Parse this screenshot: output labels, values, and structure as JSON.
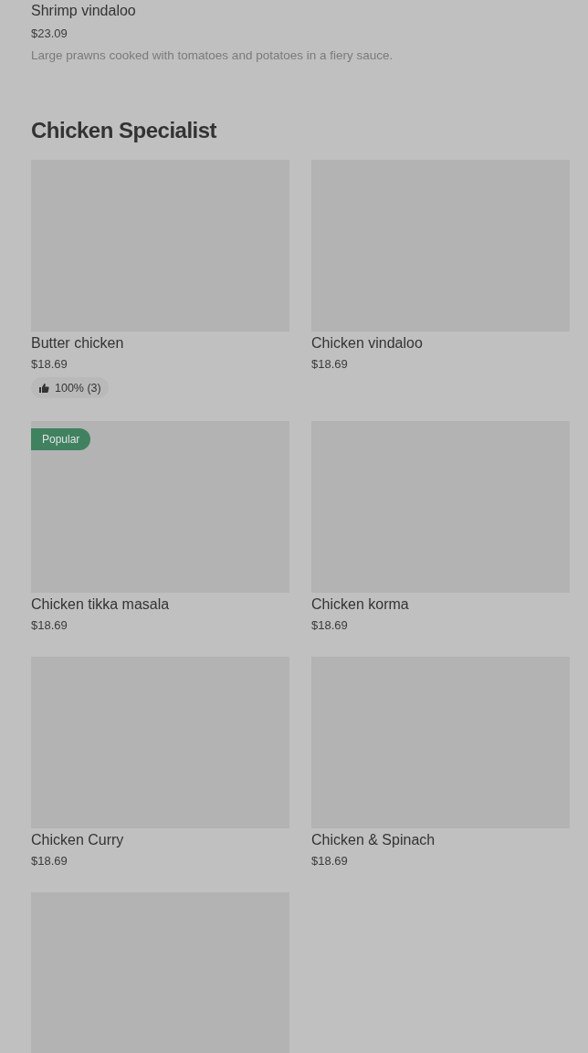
{
  "previous_item": {
    "name": "Shrimp vindaloo",
    "price": "$23.09",
    "description": "Large prawns cooked with tomatoes and potatoes in a fiery sauce."
  },
  "section": {
    "title": "Chicken Specialist",
    "items": [
      {
        "name": "Butter chicken",
        "price": "$18.69",
        "rating": "100% (3)"
      },
      {
        "name": "Chicken vindaloo",
        "price": "$18.69"
      },
      {
        "name": "Chicken tikka masala",
        "price": "$18.69",
        "badge": "Popular"
      },
      {
        "name": "Chicken korma",
        "price": "$18.69"
      },
      {
        "name": "Chicken Curry",
        "price": "$18.69"
      },
      {
        "name": "Chicken & Spinach",
        "price": "$18.69"
      },
      {
        "kind": "picture"
      }
    ]
  }
}
